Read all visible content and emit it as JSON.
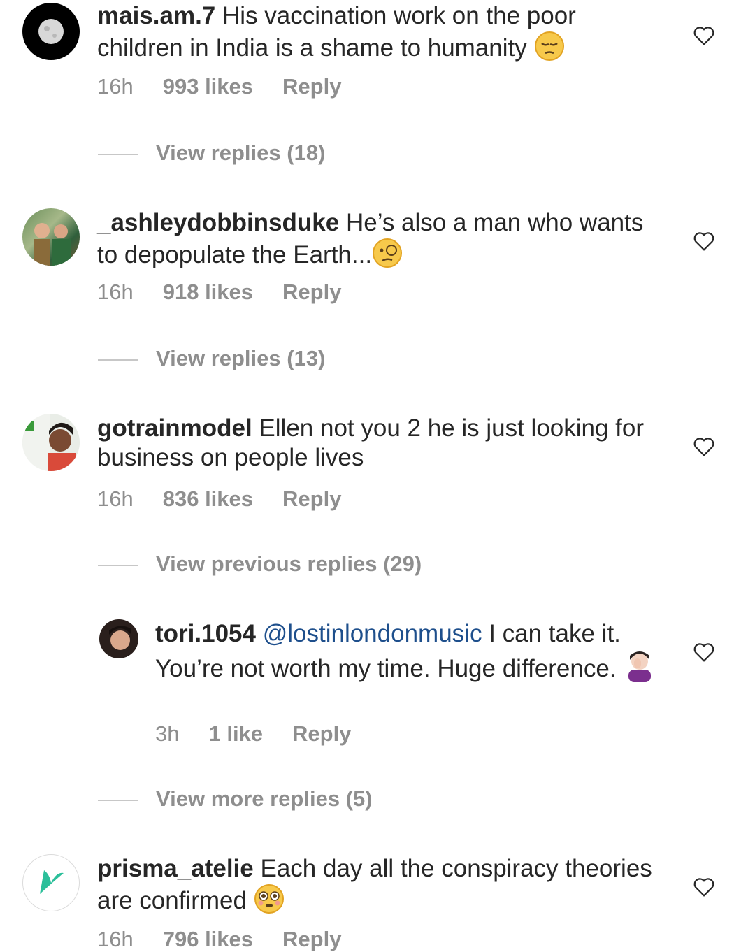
{
  "comments": [
    {
      "username": "mais.am.7",
      "text": "His vaccination work on the poor children in India is a shame to humanity",
      "emoji_icon": "pensive-face-icon",
      "time": "16h",
      "likes": "993 likes",
      "reply": "Reply",
      "view_replies": "View replies (18)"
    },
    {
      "username": "_ashleydobbinsduke",
      "text": "He’s also a man who wants to depopulate the Earth...",
      "emoji_icon": "monocle-face-icon",
      "time": "16h",
      "likes": "918 likes",
      "reply": "Reply",
      "view_replies": "View replies (13)"
    },
    {
      "username": "gotrainmodel",
      "text": "Ellen not you 2 he is just looking for business on people lives",
      "time": "16h",
      "likes": "836 likes",
      "reply": "Reply",
      "view_replies": "View previous replies (29)"
    },
    {
      "username": "tori.1054",
      "mention": "@lostinlondonmusic",
      "text": "I can take it. You’re not worth my time. Huge difference.",
      "emoji_icon": "facepalm-icon",
      "time": "3h",
      "likes": "1 like",
      "reply": "Reply",
      "view_replies": "View more replies (5)"
    },
    {
      "username": "prisma_atelie",
      "text": "Each day all the conspiracy theories are confirmed",
      "emoji_icon": "flushed-face-icon",
      "time": "16h",
      "likes": "796 likes",
      "reply": "Reply"
    }
  ],
  "colors": {
    "text": "#262626",
    "meta": "#8e8e8e",
    "mention": "#1e4f8c",
    "brand_green": "#2bbf9a"
  }
}
